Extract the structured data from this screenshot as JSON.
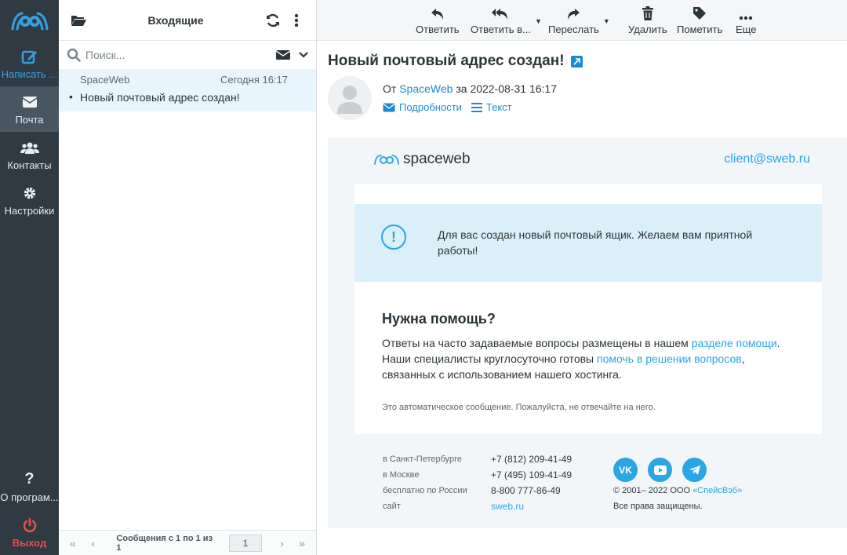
{
  "nav": {
    "compose": "Написать ...",
    "mail": "Почта",
    "contacts": "Контакты",
    "settings": "Настройки",
    "about": "О програм...",
    "logout": "Выход"
  },
  "list": {
    "title": "Входящие",
    "search_placeholder": "Поиск...",
    "messages": [
      {
        "sender": "SpaceWeb",
        "time": "Сегодня 16:17",
        "subject": "Новый почтовый адрес создан!"
      }
    ],
    "pager_text": "Сообщения с 1 по 1 из 1",
    "page": "1"
  },
  "toolbar": {
    "reply": "Ответить",
    "reply_all": "Ответить в...",
    "forward": "Переслать",
    "delete": "Удалить",
    "mark": "Пометить",
    "more": "Еще"
  },
  "message": {
    "subject": "Новый почтовый адрес создан!",
    "from_prefix": "От",
    "from_name": "SpaceWeb",
    "date_prefix": "за",
    "date": "2022-08-31 16:17",
    "details": "Подробности",
    "text": "Текст"
  },
  "email": {
    "brand": "spaceweb",
    "client_email": "client@sweb.ru",
    "notice": "Для вас создан новый почтовый ящик. Желаем вам приятной работы!",
    "help_title": "Нужна помощь?",
    "help_p1": "Ответы на часто задаваемые вопросы размещены в нашем ",
    "help_link1": "разделе помощи",
    "help_p2": ". Наши специалисты круглосуточно готовы ",
    "help_link2": "помочь в решении вопросов",
    "help_p3": ", связанных с использованием нашего хостинга.",
    "auto_note": "Это автоматическое сообщение. Пожалуйста, не отвечайте на него.",
    "contacts": [
      {
        "label": "в Санкт-Петербурге",
        "value": "+7 (812) 209-41-49"
      },
      {
        "label": "в Москве",
        "value": "+7 (495) 109-41-49"
      },
      {
        "label": "бесплатно по России",
        "value": "8-800 777-86-49"
      },
      {
        "label": "сайт",
        "value": "sweb.ru"
      }
    ],
    "copyright_prefix": "© 2001– 2022 ООО ",
    "copyright_company": "«СпейсВэб»",
    "rights": "Все права защищены."
  },
  "colors": {
    "nav_bg": "#2f3a42",
    "accent": "#1a8ad8",
    "brand": "#29a6e5",
    "logout": "#ec4b4b"
  }
}
